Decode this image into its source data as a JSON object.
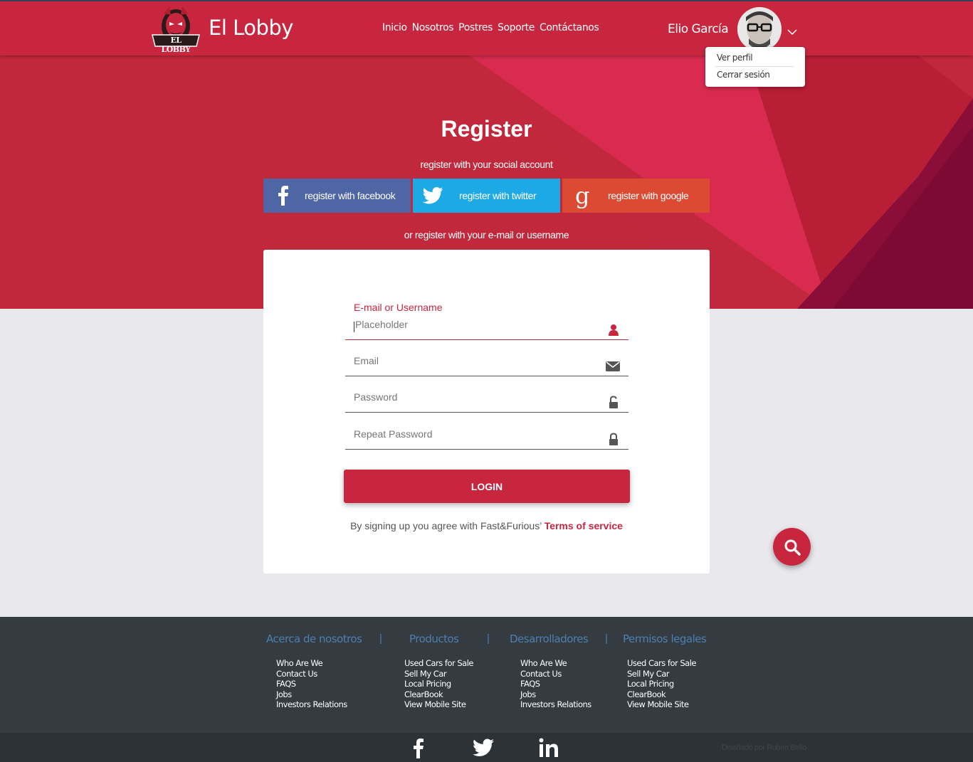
{
  "header": {
    "brand": "El Lobby",
    "logo_text": "EL LOBBY",
    "nav": [
      "Inicio",
      "Nosotros",
      "Postres",
      "Soporte",
      "Contáctanos"
    ],
    "user_name": "Elio García",
    "menu": [
      "Ver perfil",
      "Cerrar sesión"
    ]
  },
  "hero": {
    "title": "Register",
    "social_subtitle": "register with your social account",
    "social_buttons": {
      "facebook": "register with facebook",
      "twitter": "register with twitter",
      "google": "register with google"
    },
    "or_text": "or register with your e-mail or username"
  },
  "form": {
    "active_label": "E-mail or Username",
    "fields": [
      {
        "placeholder": "Placeholder",
        "icon": "user-icon"
      },
      {
        "placeholder": "Email",
        "icon": "envelope-icon"
      },
      {
        "placeholder": "Password",
        "icon": "unlock-icon"
      },
      {
        "placeholder": "Repeat Password",
        "icon": "lock-icon"
      }
    ],
    "submit": "LOGIN",
    "terms_text": "By signing up you agree with Fast&Furious’ ",
    "terms_link": "Terms of service"
  },
  "footer": {
    "columns": [
      {
        "heading": "Acerca de nosotros",
        "links": [
          "Who Are We",
          "Contact Us",
          "FAQS",
          "Jobs",
          "Investors Relations"
        ]
      },
      {
        "heading": "Productos",
        "links": [
          "Used Cars for Sale",
          "Sell My Car",
          "Local Pricing",
          "ClearBook",
          "View Mobile Site"
        ]
      },
      {
        "heading": "Desarrolladores",
        "links": [
          "Who Are We",
          "Contact Us",
          "FAQS",
          "Jobs",
          "Investors Relations"
        ]
      },
      {
        "heading": "Permisos legales",
        "links": [
          "Used Cars for Sale",
          "Sell My Car",
          "Local Pricing",
          "ClearBook",
          "View Mobile Site"
        ]
      }
    ],
    "separator": "|",
    "social_icons": [
      "facebook-icon",
      "twitter-icon",
      "linkedin-icon"
    ],
    "credit": "Diseñado por Rubén Bello"
  },
  "colors": {
    "primary": "#c8263f",
    "footer_bg": "#343b41",
    "facebook": "#4e66a3",
    "twitter": "#1da9e6",
    "google": "#dd4a34"
  }
}
